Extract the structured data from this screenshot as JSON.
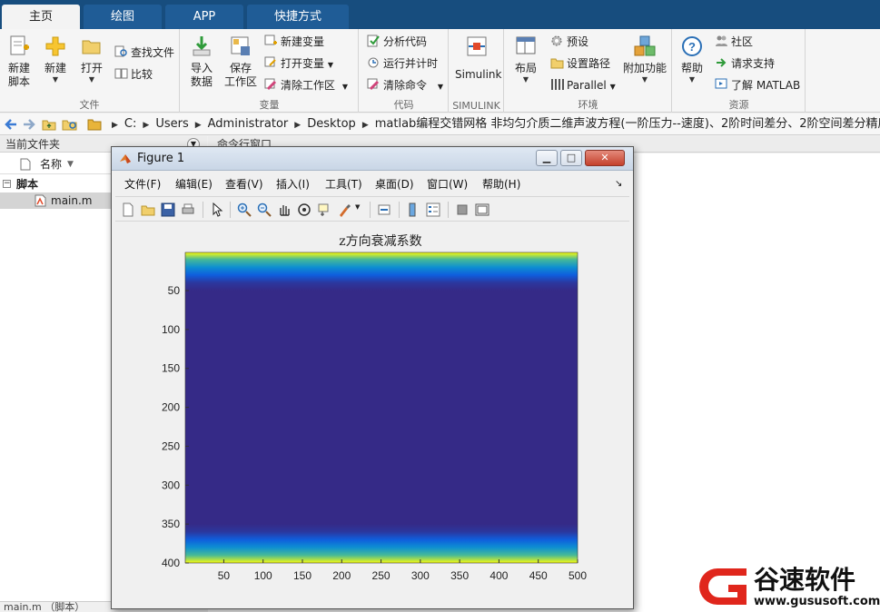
{
  "tabs": [
    {
      "label": "主页",
      "active": true
    },
    {
      "label": "绘图",
      "active": false
    },
    {
      "label": "APP",
      "active": false
    },
    {
      "label": "快捷方式",
      "active": false
    }
  ],
  "ribbon": {
    "file": {
      "group_label": "文件",
      "new_script": "新建\n脚本",
      "new": "新建",
      "open": "打开",
      "find_files": "查找文件",
      "compare": "比较"
    },
    "variable": {
      "group_label": "变量",
      "import_data": "导入\n数据",
      "save_workspace": "保存\n工作区",
      "new_variable": "新建变量",
      "open_variable": "打开变量",
      "clear_workspace": "清除工作区"
    },
    "code": {
      "group_label": "代码",
      "analyze_code": "分析代码",
      "run_and_time": "运行并计时",
      "clear_commands": "清除命令"
    },
    "simulink": {
      "group_label": "SIMULINK",
      "simulink": "Simulink"
    },
    "environment": {
      "group_label": "环境",
      "layout": "布局",
      "preferences": "预设",
      "set_path": "设置路径",
      "parallel": "Parallel",
      "addons": "附加功能"
    },
    "resources": {
      "group_label": "资源",
      "help": "帮助",
      "community": "社区",
      "request_support": "请求支持",
      "learn_matlab": "了解 MATLAB"
    }
  },
  "address": {
    "crumbs": [
      "C:",
      "Users",
      "Administrator",
      "Desktop",
      "matlab编程交错网格 非均匀介质二维声波方程(一阶压力--速度)、2阶时间差分、2阶空间差分精度源码程序"
    ]
  },
  "current_folder": {
    "title": "当前文件夹",
    "name_header": "名称",
    "group": "脚本",
    "file": "main.m",
    "status": "main.m （脚本）"
  },
  "command_window": {
    "title": "命令行窗口"
  },
  "figure": {
    "title": "Figure 1",
    "menu": [
      "文件(F)",
      "编辑(E)",
      "查看(V)",
      "插入(I)",
      "工具(T)",
      "桌面(D)",
      "窗口(W)",
      "帮助(H)"
    ]
  },
  "colors": {
    "parula_dark": "#352a87",
    "parula_yellow": "#f9e726",
    "tabstrip": "#174d7e"
  },
  "chart_data": {
    "type": "heatmap",
    "title": "z方向衰减系数",
    "xlabel": "",
    "ylabel": "",
    "xlim": [
      1,
      500
    ],
    "ylim": [
      1,
      400
    ],
    "y_reversed": true,
    "xticks": [
      50,
      100,
      150,
      200,
      250,
      300,
      350,
      400,
      450,
      500
    ],
    "yticks": [
      50,
      100,
      150,
      200,
      250,
      300,
      350,
      400
    ],
    "colormap": "parula",
    "description_values": {
      "profile_z": [
        1,
        10,
        20,
        30,
        40,
        50,
        200,
        350,
        360,
        370,
        380,
        390,
        400
      ],
      "profile_value": [
        1.0,
        0.64,
        0.36,
        0.16,
        0.04,
        0,
        0,
        0,
        0.04,
        0.16,
        0.36,
        0.64,
        1.0
      ]
    },
    "varies_along_x": false
  }
}
